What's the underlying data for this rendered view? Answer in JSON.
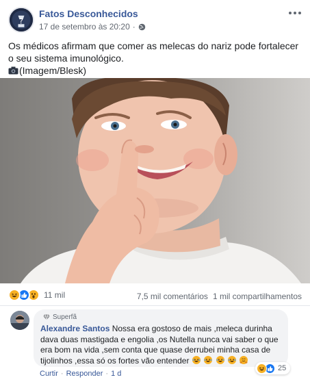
{
  "post": {
    "page_name": "Fatos Desconhecidos",
    "timestamp": "17 de setembro às 20:20",
    "separator": "·",
    "privacy_icon": "globe-icon",
    "more_icon": "more-options-icon",
    "text_line1": "Os médicos afirmam que comer as melecas do nariz pode fortalecer o seu sistema imunológico.",
    "text_line2": "(Imagem/Blesk)",
    "text_line2_icon": "camera-icon",
    "photo_description_icon": "photo-child-picking-nose"
  },
  "stats": {
    "reaction_icons": [
      "haha-icon",
      "like-icon",
      "wow-icon"
    ],
    "reaction_count": "11 mil",
    "comments": "7,5 mil comentários",
    "shares": "1 mil compartilhamentos"
  },
  "comment": {
    "badge": "Superfã",
    "badge_icon": "diamond-icon",
    "author": "Alexandre Santos",
    "text": "Nossa era gostoso de mais ,meleca durinha dava duas mastigada e engolia ,os Nutella nunca vai saber o que era bom na vida ,sem conta que quase derrubei minha casa de tijolinhos ,essa só os fortes vão entender",
    "trailing_emojis": [
      "laughing-tears-icon",
      "laughing-tears-icon",
      "laughing-tears-icon",
      "laughing-tears-icon",
      "hugging-face-icon"
    ],
    "reaction_icons": [
      "haha-icon",
      "like-icon"
    ],
    "reaction_count": "25",
    "actions": {
      "like": "Curtir",
      "reply": "Responder",
      "age": "1 d",
      "separator": "·"
    }
  },
  "colors": {
    "link_blue": "#385898",
    "secondary_text": "#606770",
    "bubble_bg": "#f2f3f5",
    "like_blue": "#1877f2",
    "haha_yellow": "#f7b125"
  }
}
